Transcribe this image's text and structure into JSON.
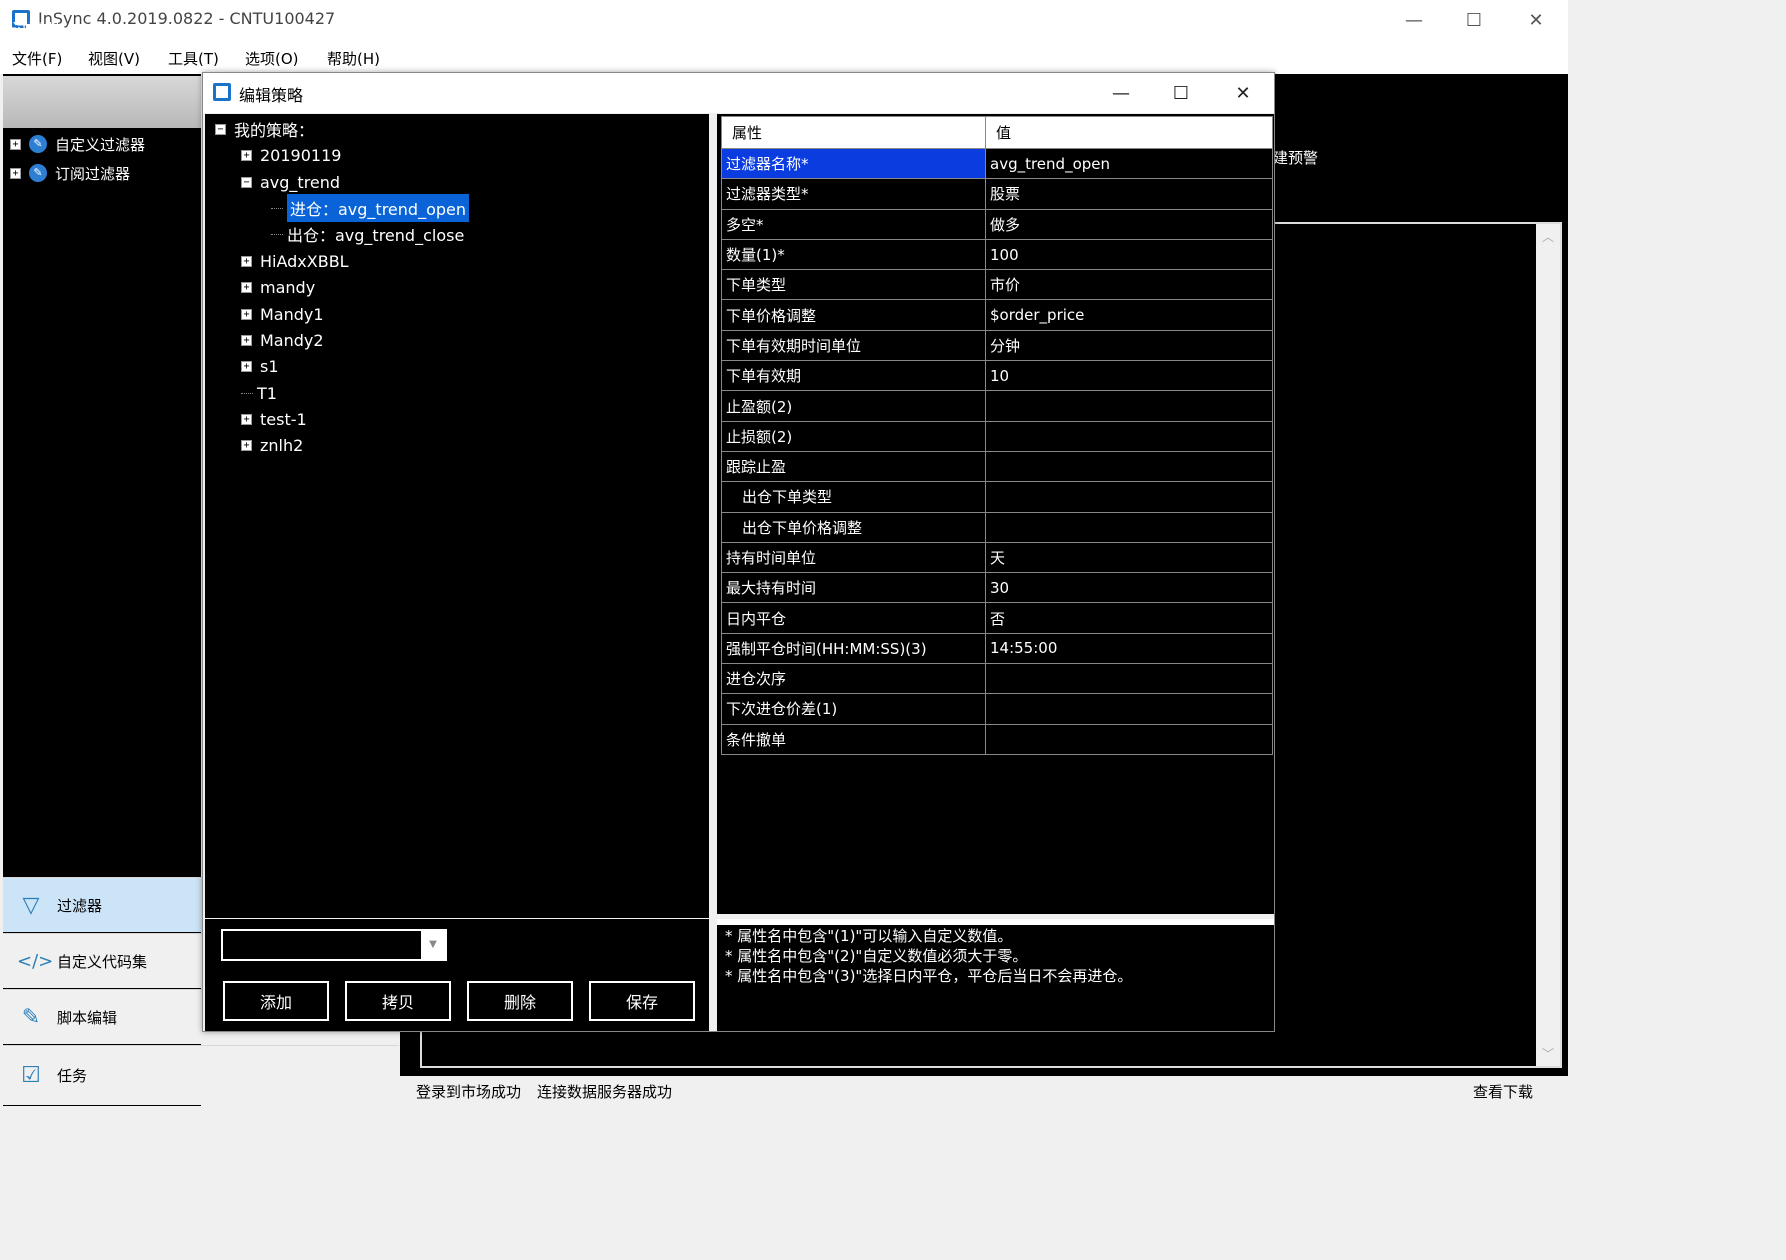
{
  "app": {
    "title": "InSync 4.0.2019.0822 - CNTU100427",
    "window_controls": {
      "minimize": "—",
      "maximize": "☐",
      "close": "✕"
    }
  },
  "menu": [
    "文件(F)",
    "视图(V)",
    "工具(T)",
    "选项(O)",
    "帮助(H)"
  ],
  "left_panel": {
    "header": "过滤器",
    "tree": [
      "自定义过滤器",
      "订阅过滤器"
    ],
    "nav": [
      {
        "label": "过滤器",
        "icon": "filter-icon"
      },
      {
        "label": "自定义代码集",
        "icon": "code-icon"
      },
      {
        "label": "脚本编辑",
        "icon": "edit-icon"
      },
      {
        "label": "任务",
        "icon": "task-icon"
      }
    ]
  },
  "background": {
    "partial_label": "建预警"
  },
  "status": {
    "left1": "登录到市场成功",
    "left2": "连接数据服务器成功",
    "right": "查看下载"
  },
  "dialog": {
    "title": "编辑策略",
    "tree": {
      "root": "我的策略：",
      "nodes": [
        {
          "label": "20190119",
          "expand": "+"
        },
        {
          "label": "avg_trend",
          "expand": "−"
        },
        {
          "label": "进仓：avg_trend_open",
          "child": true,
          "selected": true
        },
        {
          "label": "出仓：avg_trend_close",
          "child": true
        },
        {
          "label": "HiAdxXBBL",
          "expand": "+"
        },
        {
          "label": "mandy",
          "expand": "+"
        },
        {
          "label": "Mandy1",
          "expand": "+"
        },
        {
          "label": "Mandy2",
          "expand": "+"
        },
        {
          "label": "s1",
          "expand": "+"
        },
        {
          "label": "T1",
          "expand": ""
        },
        {
          "label": "test-1",
          "expand": "+"
        },
        {
          "label": "znlh2",
          "expand": "+"
        }
      ]
    },
    "combo_value": "",
    "buttons": {
      "add": "添加",
      "copy": "拷贝",
      "delete": "删除",
      "save": "保存"
    },
    "table": {
      "headers": [
        "属性",
        "值"
      ],
      "rows": [
        {
          "name": "过滤器名称*",
          "value": "avg_trend_open",
          "selected": true
        },
        {
          "name": "过滤器类型*",
          "value": "股票"
        },
        {
          "name": "多空*",
          "value": "做多"
        },
        {
          "name": "数量(1)*",
          "value": "100"
        },
        {
          "name": "下单类型",
          "value": "市价"
        },
        {
          "name": "下单价格调整",
          "value": "$order_price"
        },
        {
          "name": "下单有效期时间单位",
          "value": "分钟"
        },
        {
          "name": "下单有效期",
          "value": "10"
        },
        {
          "name": "止盈额(2)",
          "value": ""
        },
        {
          "name": "止损额(2)",
          "value": ""
        },
        {
          "name": "跟踪止盈",
          "value": ""
        },
        {
          "name": "出仓下单类型",
          "value": "",
          "indent": true
        },
        {
          "name": "出仓下单价格调整",
          "value": "",
          "indent": true
        },
        {
          "name": "持有时间单位",
          "value": "天"
        },
        {
          "name": "最大持有时间",
          "value": "30"
        },
        {
          "name": "日内平仓",
          "value": "否"
        },
        {
          "name": "强制平仓时间(HH:MM:SS)(3)",
          "value": "14:55:00"
        },
        {
          "name": "进仓次序",
          "value": ""
        },
        {
          "name": "下次进仓价差(1)",
          "value": ""
        },
        {
          "name": "条件撤单",
          "value": ""
        }
      ]
    },
    "notes": [
      "* 属性名中包含\"(1)\"可以输入自定义数值。",
      "* 属性名中包含\"(2)\"自定义数值必须大于零。",
      "* 属性名中包含\"(3)\"选择日内平仓，平仓后当日不会再进仓。"
    ]
  }
}
